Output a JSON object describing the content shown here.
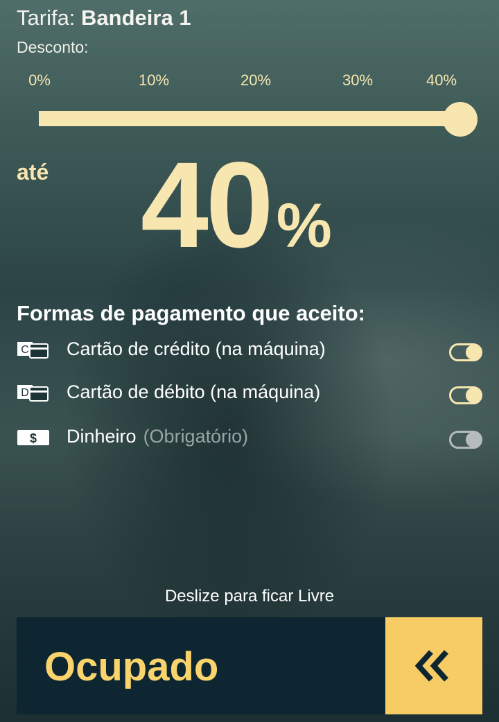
{
  "header": {
    "tarifa_label": "Tarifa:",
    "tarifa_value": "Bandeira 1",
    "desconto_label": "Desconto:"
  },
  "slider": {
    "ticks": [
      "0%",
      "10%",
      "20%",
      "30%",
      "40%"
    ],
    "value_percent": 40,
    "max_percent": 40,
    "color": "#f7e6b0"
  },
  "discount": {
    "prefix": "até",
    "value": "40",
    "unit": "%"
  },
  "payment": {
    "title": "Formas de pagamento que aceito:",
    "items": [
      {
        "icon": "credit-card-icon",
        "label": "Cartão de crédito (na máquina)",
        "note": "",
        "enabled": true
      },
      {
        "icon": "debit-card-icon",
        "label": "Cartão de débito (na máquina)",
        "note": "",
        "enabled": true
      },
      {
        "icon": "cash-icon",
        "label": "Dinheiro",
        "note": "(Obrigatório)",
        "enabled": true,
        "locked": true
      }
    ]
  },
  "swipe": {
    "hint": "Deslize para ficar Livre",
    "status": "Ocupado",
    "handle_icon": "double-chevron-left-icon",
    "accent_color": "#f8cc64",
    "background_color": "#0e2632"
  }
}
